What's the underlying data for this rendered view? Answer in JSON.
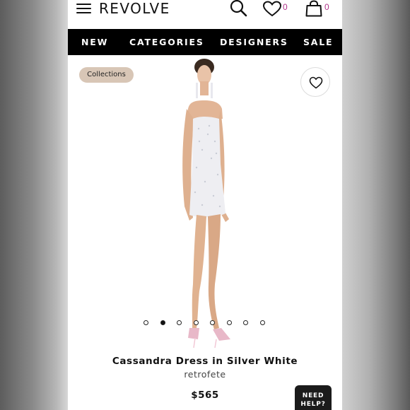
{
  "header": {
    "brand": "REVOLVE",
    "wishlist_count": "0",
    "bag_count": "0"
  },
  "nav": {
    "items": [
      "NEW",
      "CATEGORIES",
      "DESIGNERS",
      "SALE"
    ]
  },
  "product": {
    "collections_label": "Collections",
    "title": "Cassandra Dress in Silver White",
    "designer": "retrofete",
    "price": "$565",
    "image_count": 8,
    "active_image": 2
  },
  "help": {
    "line1": "NEED",
    "line2": "HELP?"
  },
  "colors": {
    "nav_bg": "#000000",
    "chip_bg": "#d8c6b6",
    "count": "#b0338a"
  }
}
